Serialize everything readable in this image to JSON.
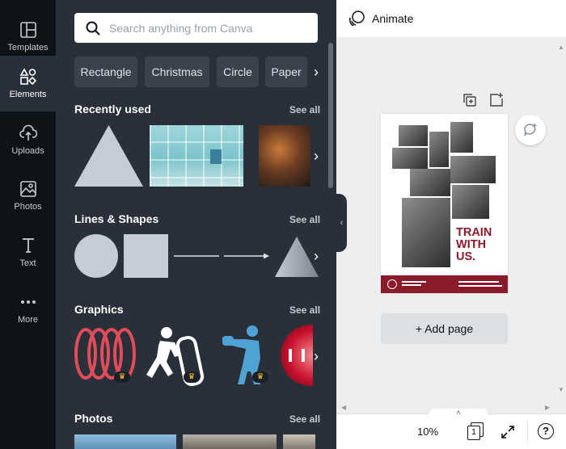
{
  "rail": {
    "items": [
      {
        "label": "Templates",
        "icon": "templates-icon"
      },
      {
        "label": "Elements",
        "icon": "elements-icon"
      },
      {
        "label": "Uploads",
        "icon": "uploads-icon"
      },
      {
        "label": "Photos",
        "icon": "photos-icon"
      },
      {
        "label": "Text",
        "icon": "text-icon"
      },
      {
        "label": "More",
        "icon": "more-icon"
      }
    ],
    "active": "Elements"
  },
  "panel": {
    "search": {
      "placeholder": "Search anything from Canva",
      "value": ""
    },
    "chips": [
      "Rectangle",
      "Christmas",
      "Circle",
      "Paper"
    ],
    "sections": {
      "recent": {
        "title": "Recently used",
        "see_all": "See all"
      },
      "lines": {
        "title": "Lines & Shapes",
        "see_all": "See all"
      },
      "graphics": {
        "title": "Graphics",
        "see_all": "See all"
      },
      "photos": {
        "title": "Photos",
        "see_all": "See all"
      }
    }
  },
  "canvas": {
    "animate_label": "Animate",
    "poster": {
      "headline": "TRAIN WITH US."
    },
    "add_page_label": "+ Add page",
    "zoom": "10%",
    "page_count": "1",
    "help": "?"
  },
  "colors": {
    "rail_bg": "#0e1318",
    "panel_bg": "#293039",
    "accent_red": "#8b1a2a",
    "shape_fill": "#c5ccd6"
  }
}
